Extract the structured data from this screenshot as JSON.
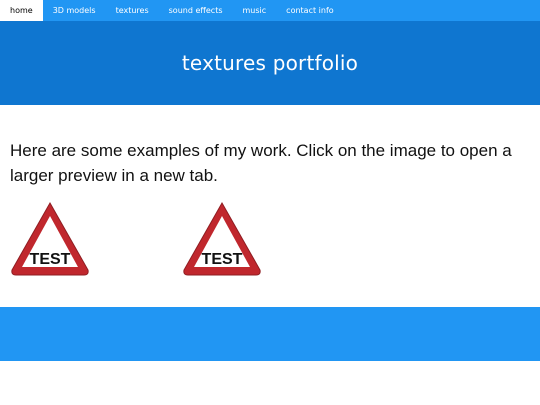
{
  "nav": {
    "items": [
      {
        "label": "home",
        "active": true
      },
      {
        "label": "3D models",
        "active": false
      },
      {
        "label": "textures",
        "active": false
      },
      {
        "label": "sound effects",
        "active": false
      },
      {
        "label": "music",
        "active": false
      },
      {
        "label": "contact info",
        "active": false
      }
    ]
  },
  "hero": {
    "title": "textures portfolio"
  },
  "main": {
    "intro": "Here are some examples of my work. Click on the image to open a larger preview in a new tab.",
    "images": [
      {
        "sign_text": "TEST",
        "icon": "warning-triangle-sign"
      },
      {
        "sign_text": "TEST",
        "icon": "warning-triangle-sign"
      }
    ]
  },
  "colors": {
    "nav_bg": "#2196f3",
    "hero_bg": "#0f76d0",
    "footer_bg": "#2196f3",
    "sign_red": "#c0272d"
  }
}
